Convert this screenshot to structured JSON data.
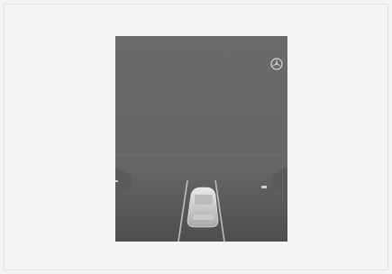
{
  "screen": {
    "brand_icon": "mercedes-star-icon",
    "ego_vehicle_icon": "car-rear-icon",
    "colors": {
      "background": "#f3f4f3",
      "display": "#676767",
      "road": "#5a5a5a",
      "lane_lines": "#bdbdbd",
      "vehicle": "#d8d8d8"
    }
  }
}
